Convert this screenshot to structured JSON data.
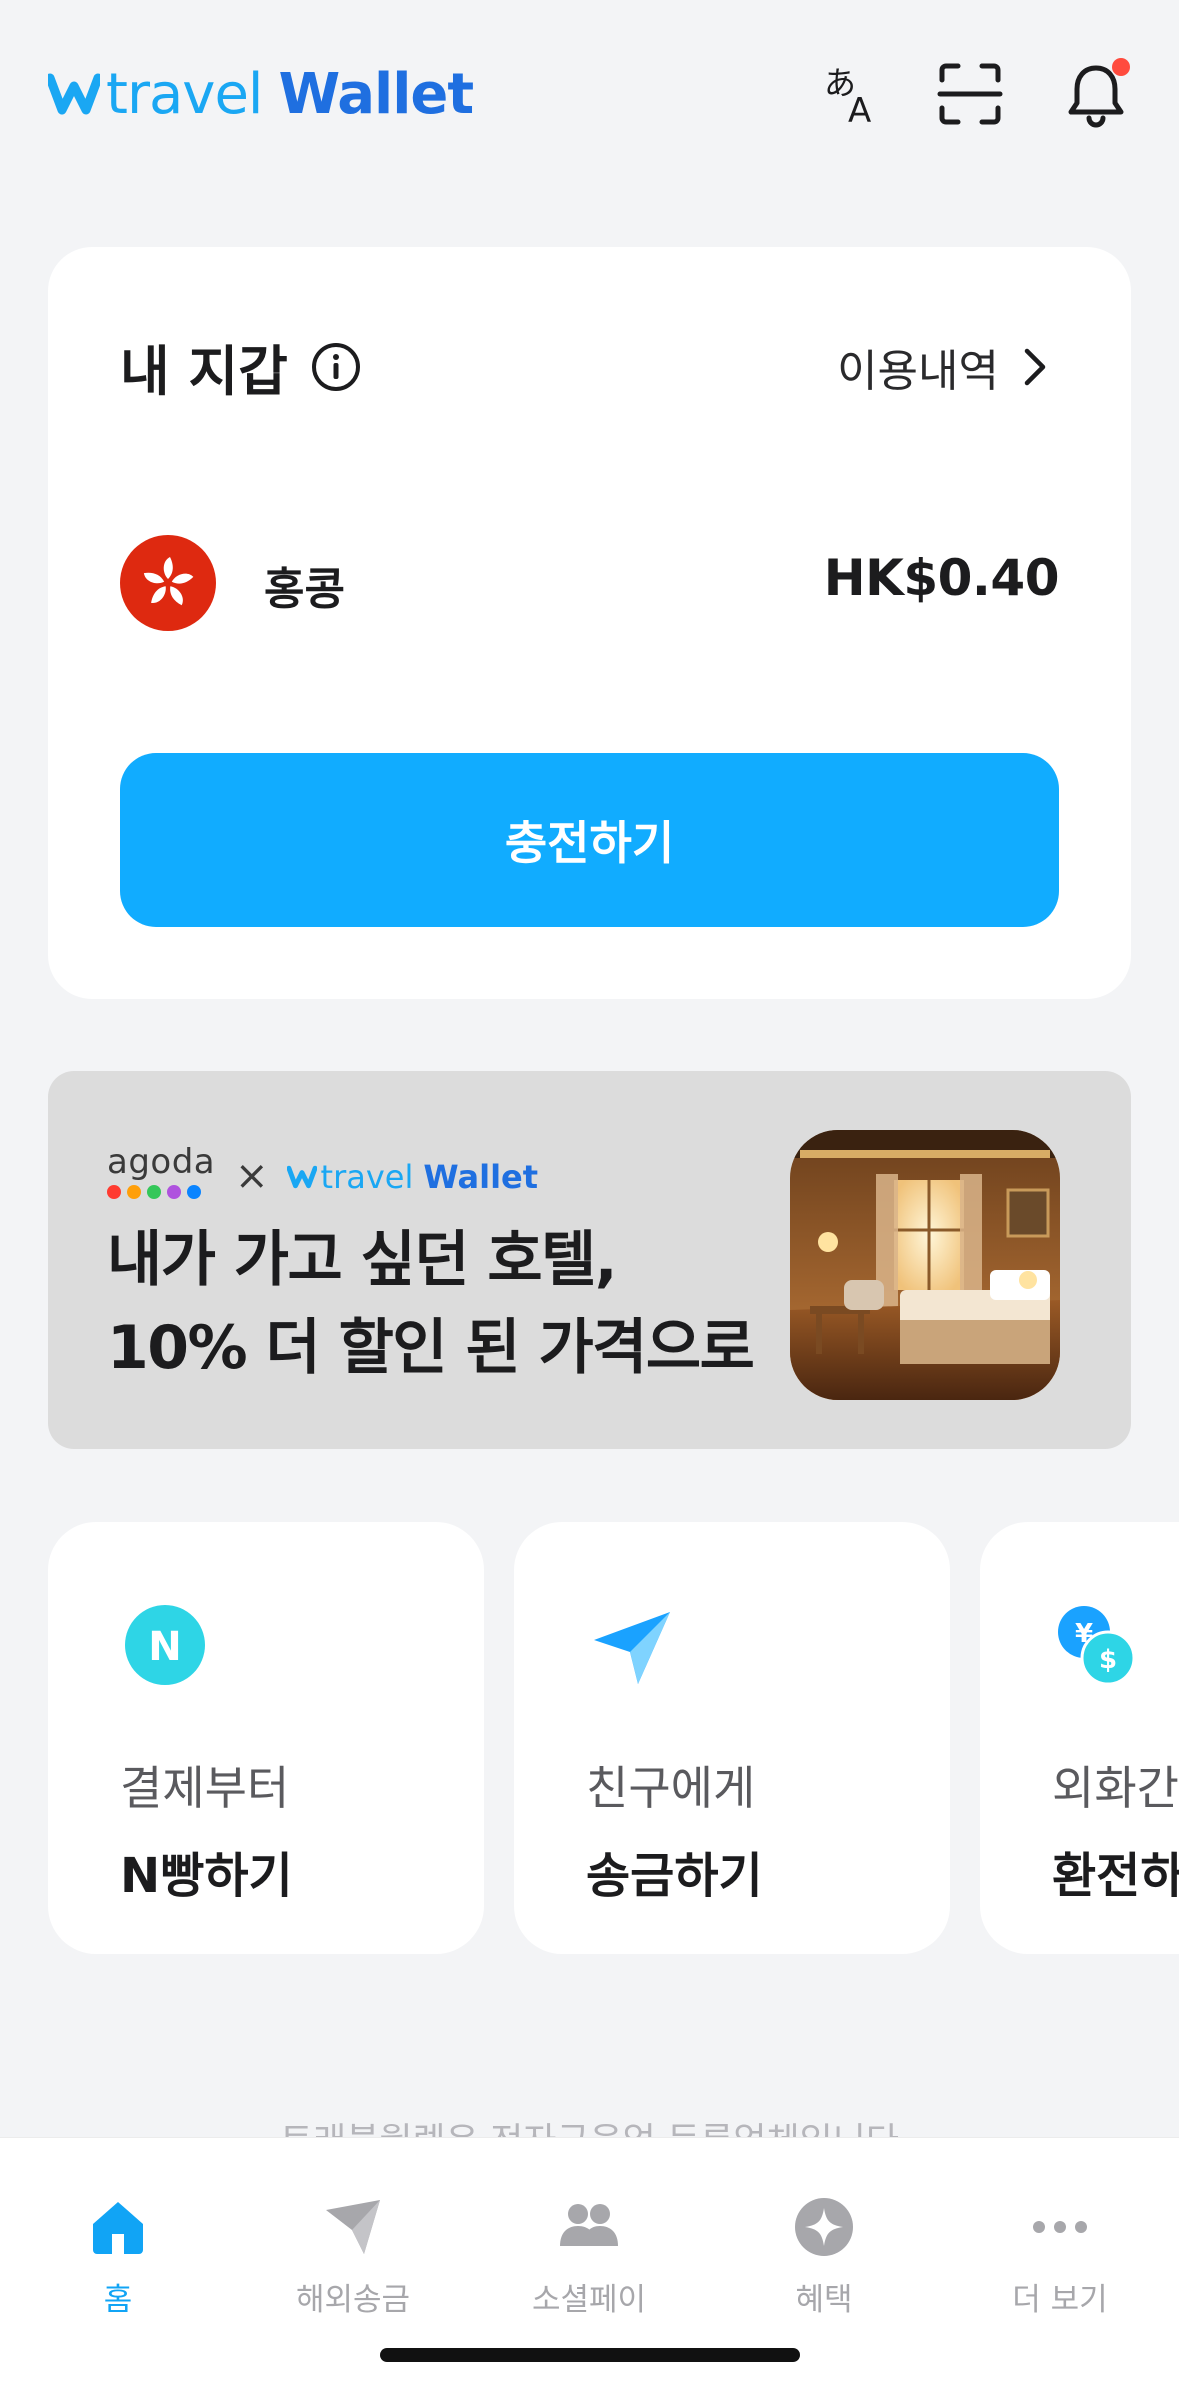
{
  "header": {
    "logo_travel": "travel",
    "logo_wallet": "Wallet",
    "notification_dot": true
  },
  "wallet": {
    "title": "내 지갑",
    "history_label": "이용내역",
    "currency_name": "홍콩",
    "balance": "HK$0.40",
    "charge_button": "충전하기"
  },
  "banner": {
    "partner": "agoda",
    "partner_dot_colors": [
      "#ff3b30",
      "#ff9f0a",
      "#34c759",
      "#af52de",
      "#0a84ff"
    ],
    "brand_travel": "travel",
    "brand_wallet": "Wallet",
    "line1": "내가 가고 싶던 호텔,",
    "line2": "10% 더 할인 된 가격으로"
  },
  "features": [
    {
      "icon": "n-badge-icon",
      "sub": "결제부터",
      "main": "N빵하기"
    },
    {
      "icon": "paper-plane-icon",
      "sub": "친구에게",
      "main": "송금하기"
    },
    {
      "icon": "currency-exchange-icon",
      "sub": "외화간",
      "main": "환전하"
    }
  ],
  "notice": "트래블월렛은 전자금융업 등록업체입니다",
  "tabs": [
    {
      "icon": "home-icon",
      "label": "홈",
      "active": true
    },
    {
      "icon": "send-icon",
      "label": "해외송금",
      "active": false
    },
    {
      "icon": "people-icon",
      "label": "소셜페이",
      "active": false
    },
    {
      "icon": "benefit-icon",
      "label": "혜택",
      "active": false
    },
    {
      "icon": "more-icon",
      "label": "더 보기",
      "active": false
    }
  ],
  "colors": {
    "accent": "#11acff",
    "brand_blue": "#1f6fe0",
    "brand_light_blue": "#1aa7f3",
    "notification": "#ff4b3e",
    "hk_red": "#de2910"
  }
}
